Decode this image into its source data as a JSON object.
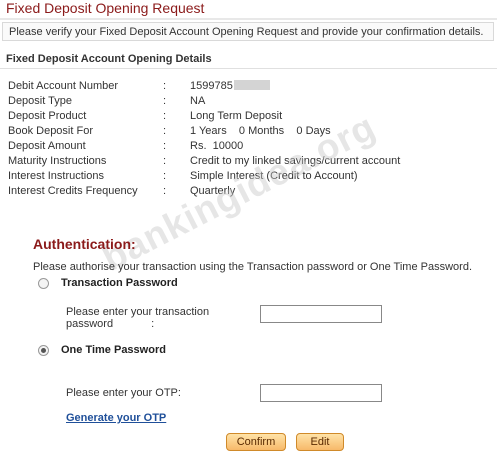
{
  "page": {
    "title": "Fixed Deposit Opening Request",
    "notice": "Please verify your Fixed Deposit Account Opening Request and provide your confirmation details."
  },
  "details": {
    "heading": "Fixed Deposit Account Opening Details",
    "rows": [
      {
        "label": "Debit Account Number",
        "sep": ":",
        "value": "1599785"
      },
      {
        "label": "Deposit Type",
        "sep": ":",
        "value": "NA"
      },
      {
        "label": "Deposit Product",
        "sep": ":",
        "value": "Long Term Deposit"
      },
      {
        "label": "Book Deposit For",
        "sep": ":",
        "value": "1 Years    0 Months    0 Days"
      },
      {
        "label": "Deposit Amount",
        "sep": ":",
        "value": "Rs.  10000"
      },
      {
        "label": "Maturity Instructions",
        "sep": ":",
        "value": "Credit to my linked savings/current account"
      },
      {
        "label": "Interest Instructions",
        "sep": ":",
        "value": "Simple Interest (Credit to Account)"
      },
      {
        "label": "Interest Credits Frequency",
        "sep": ":",
        "value": "Quarterly"
      }
    ]
  },
  "watermark": "bankingidea.org",
  "auth": {
    "title": "Authentication:",
    "description": "Please authorise your transaction using the Transaction password or One Time Password.",
    "transaction_password": {
      "label": "Transaction Password",
      "selected": false,
      "field_label_line1": "Please enter your transaction",
      "field_label_line2": "password",
      "field_label_colon": ":",
      "value": ""
    },
    "otp": {
      "label": "One Time Password",
      "selected": true,
      "field_label": "Please enter your OTP:",
      "value": ""
    },
    "generate_link": "Generate your OTP"
  },
  "buttons": {
    "confirm": "Confirm",
    "edit": "Edit"
  },
  "colors": {
    "title": "#8b1a1a",
    "link": "#1f4f99",
    "button_border": "#d08a2a"
  }
}
